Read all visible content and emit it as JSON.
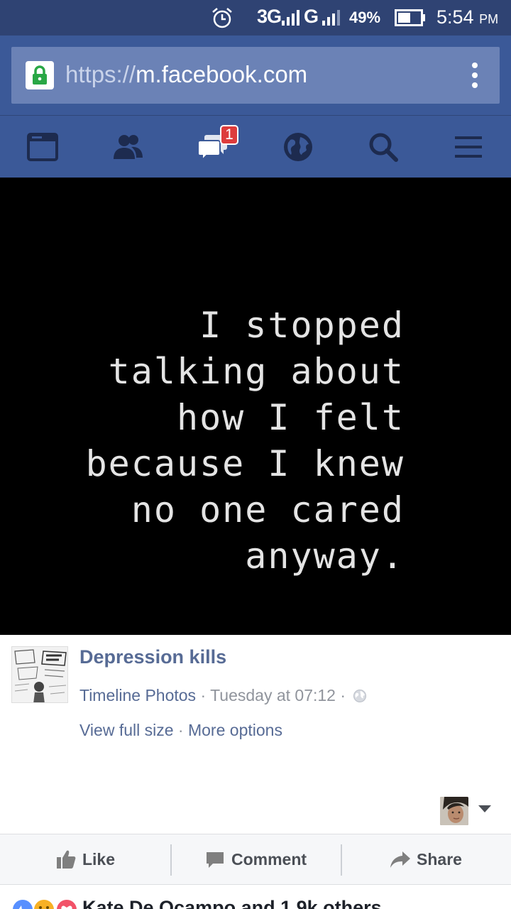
{
  "status_bar": {
    "network_1": "3G",
    "network_2": "G",
    "battery": "49%",
    "time": "5:54",
    "time_suffix": "PM"
  },
  "browser": {
    "url_scheme": "https://",
    "url_host": "m.facebook.com"
  },
  "nav": {
    "items": [
      "news-feed",
      "friend-requests",
      "messages",
      "notifications",
      "search",
      "menu"
    ],
    "messages_badge": "1"
  },
  "photo": {
    "quote_lines": [
      "I stopped",
      "talking about",
      "how I felt",
      "because I knew",
      "no one cared",
      "anyway."
    ]
  },
  "post": {
    "page_name": "Depression kills",
    "album": "Timeline Photos",
    "separator": " · ",
    "timestamp": "Tuesday at 07:12",
    "view_full_size": "View full size",
    "more_options": "More options"
  },
  "actions": {
    "like": "Like",
    "comment": "Comment",
    "share": "Share"
  },
  "reactions": {
    "text": "Kate De Ocampo and 1.9k others"
  },
  "colors": {
    "facebook_blue": "#3b5998",
    "status_bar": "#2f4373",
    "link": "#576b95",
    "badge": "#dd3c3c"
  }
}
